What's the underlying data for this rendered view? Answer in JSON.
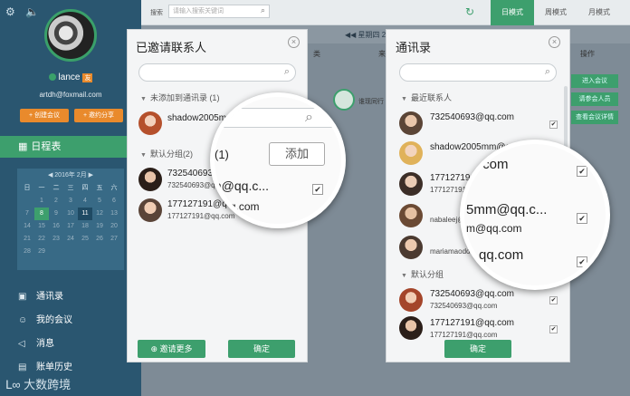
{
  "sidebar": {
    "user": {
      "name": "lance",
      "badge": "友",
      "email": "artdh@foxmail.com"
    },
    "buttons": {
      "create": "+ 创建会议",
      "share": "+ 邀约分享"
    },
    "nav_calendar": "日程表",
    "calendar": {
      "header": "◀ 2016年 2月 ▶",
      "weekdays": [
        "日",
        "一",
        "二",
        "三",
        "四",
        "五",
        "六"
      ],
      "days": [
        "",
        "1",
        "2",
        "3",
        "4",
        "5",
        "6",
        "7",
        "8",
        "9",
        "10",
        "11",
        "12",
        "13",
        "14",
        "15",
        "16",
        "17",
        "18",
        "19",
        "20",
        "21",
        "22",
        "23",
        "24",
        "25",
        "26",
        "27",
        "28",
        "29",
        "",
        "",
        "",
        "",
        ""
      ]
    },
    "nav_items": [
      {
        "icon": "contacts-icon",
        "label": "通讯录"
      },
      {
        "icon": "meeting-icon",
        "label": "我的会议"
      },
      {
        "icon": "message-icon",
        "label": "消息"
      },
      {
        "icon": "bill-icon",
        "label": "账单历史"
      }
    ],
    "watermark": "大数跨境"
  },
  "topbar": {
    "search_label": "搜索",
    "search_placeholder": "请输入搜索关键词",
    "modes": [
      "日模式",
      "周模式",
      "月模式"
    ],
    "active_mode": "日模式"
  },
  "background": {
    "date": "◀◀ 星期四 2月 ▶",
    "action_header": "操作",
    "col_a": "类",
    "col_b": "来源",
    "colleague": "谁现同行",
    "action_buttons": [
      "进入会议",
      "请参会人员",
      "查看会议详情"
    ]
  },
  "left_modal": {
    "title": "已邀请联系人",
    "group_unadded": "未添加到通讯录 (1)",
    "group_default": "默认分组(2)",
    "people": [
      {
        "name": "shadow2005mm",
        "email": "",
        "checked": false
      },
      {
        "name": "732540693",
        "email": "732540693@qq.com",
        "checked": false
      },
      {
        "name": "177127191@qq.com",
        "email": "177127191@qq.com",
        "checked": true
      }
    ],
    "invite_more": "邀请更多",
    "confirm": "确定",
    "lens": {
      "group": "(1)",
      "add": "添加",
      "line1": "m@qq.c...",
      "line2": "@qq.com"
    }
  },
  "right_modal": {
    "title": "通讯录",
    "group_recent": "最近联系人",
    "group_default": "默认分组",
    "recent": [
      {
        "name": "732540693@qq.com",
        "email": "",
        "checked": true
      },
      {
        "name": "shadow2005mm@qq.com",
        "email": "",
        "checked": true
      },
      {
        "name": "177127191@qq.com",
        "email": "177127191@qq.com",
        "checked": true
      },
      {
        "name": "nabaleej@qq.com",
        "email": "",
        "checked": true
      },
      {
        "name": "mariamaodong@qq.com",
        "email": "",
        "checked": true
      }
    ],
    "default": [
      {
        "name": "732540693@qq.com",
        "email": "732540693@qq.com",
        "checked": true
      },
      {
        "name": "177127191@qq.com",
        "email": "177127191@qq.com",
        "checked": true
      }
    ],
    "confirm": "确定",
    "lens": {
      "l1": ".com",
      "l2": "5mm@qq.c...",
      "l3": "m@qq.com",
      "l4": "qq.com"
    }
  },
  "colors": {
    "accent": "#3d9f6d",
    "sidebar": "#2a5670",
    "orange": "#e98a2c"
  }
}
